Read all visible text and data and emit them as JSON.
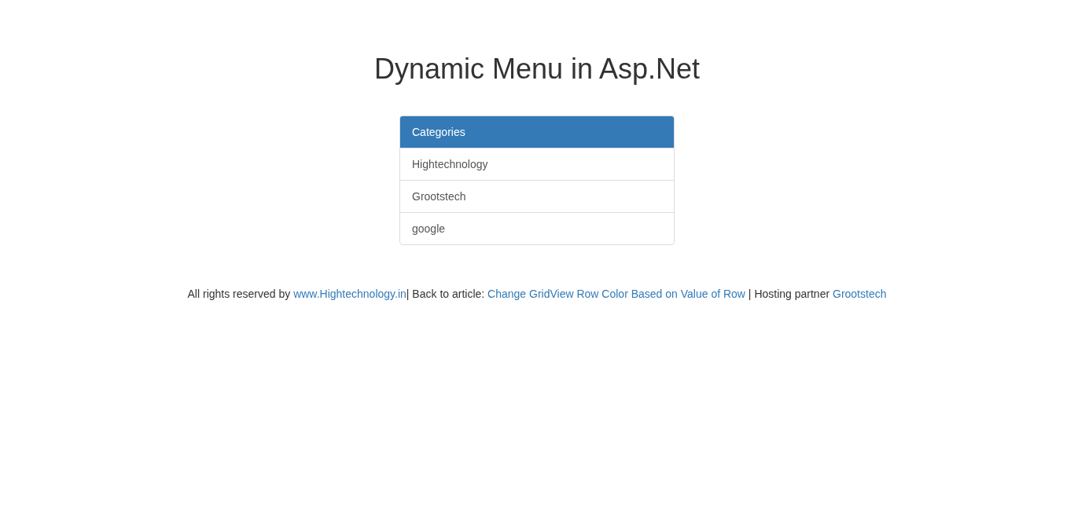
{
  "page_title": "Dynamic Menu in Asp.Net",
  "menu": {
    "heading": "Categories",
    "items": [
      {
        "label": "Hightechnology"
      },
      {
        "label": "Grootstech"
      },
      {
        "label": "google"
      }
    ]
  },
  "footer": [
    {
      "kind": "text",
      "text": "All rights reserved by "
    },
    {
      "kind": "link",
      "text": "www.Hightechnology.in"
    },
    {
      "kind": "text",
      "text": "| Back to article: "
    },
    {
      "kind": "link",
      "text": "Change GridView Row Color Based on Value of Row"
    },
    {
      "kind": "text",
      "text": " | Hosting partner "
    },
    {
      "kind": "link",
      "text": "Grootstech"
    }
  ]
}
